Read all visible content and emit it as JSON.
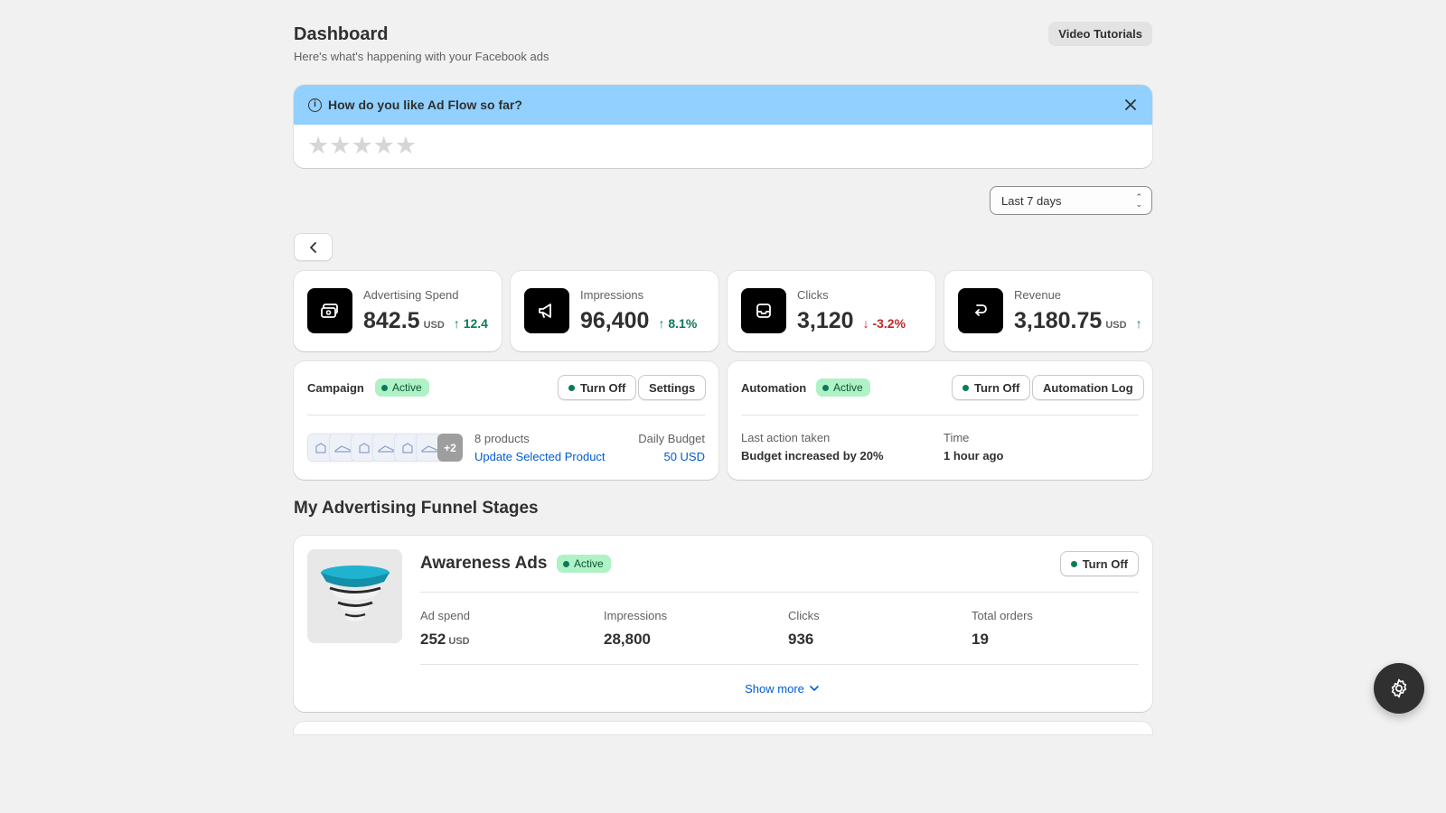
{
  "header": {
    "title": "Dashboard",
    "subtitle": "Here's what's happening with your Facebook ads",
    "tutorials_button": "Video Tutorials"
  },
  "feedback_banner": {
    "title": "How do you like Ad Flow so far?",
    "stars": [
      "★",
      "★",
      "★",
      "★",
      "★"
    ],
    "rating": 0
  },
  "date_range": {
    "selected": "Last 7 days"
  },
  "metrics": [
    {
      "label": "Advertising Spend",
      "value": "842.5",
      "unit": "USD",
      "change": "12.4",
      "direction": "up",
      "icon": "money-icon"
    },
    {
      "label": "Impressions",
      "value": "96,400",
      "unit": "",
      "change": "8.1%",
      "direction": "up",
      "icon": "megaphone-icon"
    },
    {
      "label": "Clicks",
      "value": "3,120",
      "unit": "",
      "change": "-3.2%",
      "direction": "down",
      "icon": "inbox-icon"
    },
    {
      "label": "Revenue",
      "value": "3,180.75",
      "unit": "USD",
      "change": "",
      "direction": "up",
      "icon": "return-arrow-icon"
    }
  ],
  "campaign": {
    "title": "Campaign",
    "status": "Active",
    "turn_off": "Turn Off",
    "settings": "Settings",
    "more_count": "+2",
    "products_count": "8 products",
    "update_link": "Update Selected Product",
    "budget_label": "Daily Budget",
    "budget_value": "50 USD"
  },
  "automation": {
    "title": "Automation",
    "status": "Active",
    "turn_off": "Turn Off",
    "log_button": "Automation Log",
    "last_action_label": "Last action taken",
    "last_action_value": "Budget increased by 20%",
    "time_label": "Time",
    "time_value": "1 hour ago"
  },
  "funnel": {
    "section_title": "My Advertising Funnel Stages",
    "stage": {
      "title": "Awareness Ads",
      "status": "Active",
      "turn_off": "Turn Off",
      "ad_spend_label": "Ad spend",
      "ad_spend_value": "252",
      "ad_spend_unit": "USD",
      "impressions_label": "Impressions",
      "impressions_value": "28,800",
      "clicks_label": "Clicks",
      "clicks_value": "936",
      "orders_label": "Total orders",
      "orders_value": "19",
      "show_more": "Show more"
    }
  },
  "colors": {
    "banner": "#91d0ff",
    "active_badge": "#aff2c6",
    "positive": "#0b7a5b",
    "negative": "#c1262b",
    "link": "#005bd3"
  }
}
